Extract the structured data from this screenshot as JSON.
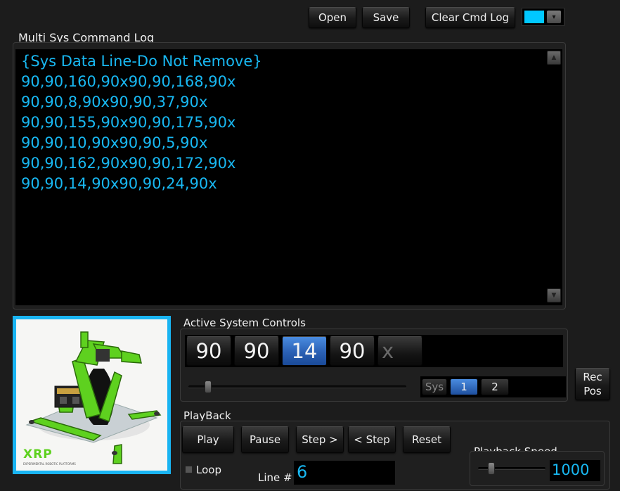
{
  "toolbar": {
    "open_label": "Open",
    "save_label": "Save",
    "clear_label": "Clear Cmd Log",
    "color_swatch": "#00c8ff"
  },
  "log": {
    "title": "Multi Sys Command Log",
    "lines": [
      "{Sys Data Line-Do Not Remove}",
      "90,90,160,90x90,90,168,90x",
      "90,90,8,90x90,90,37,90x",
      "90,90,155,90x90,90,175,90x",
      "90,90,10,90x90,90,5,90x",
      "90,90,162,90x90,90,172,90x",
      "90,90,14,90x90,90,24,90x"
    ],
    "text_color": "#18b8f2"
  },
  "robot_image": {
    "logo_text": "XRP",
    "logo_subtext": "EXPERIMENTAL ROBOTIC PLATFORMS",
    "frame_color": "#19b4f2",
    "robot_color": "#5ed11f"
  },
  "active_controls": {
    "title": "Active System Controls",
    "values": [
      "90",
      "90",
      "14",
      "90",
      "x"
    ],
    "active_index": 2,
    "slider_fraction": 0.09,
    "sys_label": "Sys",
    "sys_buttons": [
      "1",
      "2"
    ],
    "active_sys": "1",
    "rec_label_1": "Rec",
    "rec_label_2": "Pos"
  },
  "playback": {
    "title": "PlayBack",
    "buttons": [
      "Play",
      "Pause",
      "Step >",
      "< Step",
      "Reset"
    ],
    "loop_label": "Loop",
    "line_label": "Line #",
    "line_value": "6",
    "speed_title": "Playback Speed",
    "speed_value": "1000",
    "speed_fraction": 0.2
  }
}
